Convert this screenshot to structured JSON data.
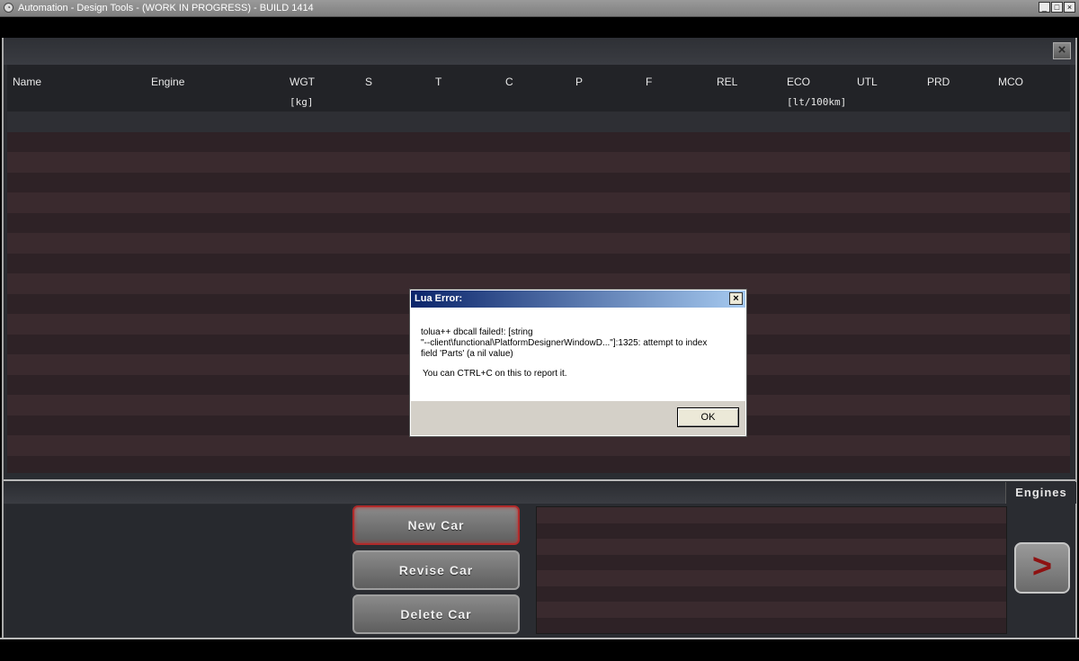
{
  "window": {
    "title": "Automation - Design Tools - (WORK IN PROGRESS) - BUILD 1414",
    "minimize": "_",
    "maximize": "□",
    "close": "×"
  },
  "panel": {
    "close_label": "×"
  },
  "table": {
    "columns": [
      {
        "label": "Name",
        "unit": ""
      },
      {
        "label": "Engine",
        "unit": ""
      },
      {
        "label": "WGT",
        "unit": "[kg]"
      },
      {
        "label": "S",
        "unit": ""
      },
      {
        "label": "T",
        "unit": ""
      },
      {
        "label": "C",
        "unit": ""
      },
      {
        "label": "P",
        "unit": ""
      },
      {
        "label": "F",
        "unit": ""
      },
      {
        "label": "REL",
        "unit": ""
      },
      {
        "label": "ECO",
        "unit": "[lt/100km]"
      },
      {
        "label": "UTL",
        "unit": ""
      },
      {
        "label": "PRD",
        "unit": ""
      },
      {
        "label": "MCO",
        "unit": ""
      }
    ]
  },
  "bottom": {
    "tab_label": "Engines",
    "buttons": {
      "new_car": "New Car",
      "revise_car": "Revise Car",
      "delete_car": "Delete Car"
    },
    "next_label": ">"
  },
  "dialog": {
    "title": "Lua Error:",
    "close": "×",
    "message_line1": "tolua++ dbcall failed!: [string",
    "message_line2": "\"--client\\functional\\PlatformDesignerWindowD...\"]:1325: attempt to index",
    "message_line3": "field 'Parts' (a nil value)",
    "hint": "You can CTRL+C on this to report it.",
    "ok_label": "OK"
  },
  "colors": {
    "row_odd": "#3a2a2e",
    "row_even": "#2e2226",
    "active_button_border": "#b02a2a",
    "dialog_title": "#0a246a"
  }
}
